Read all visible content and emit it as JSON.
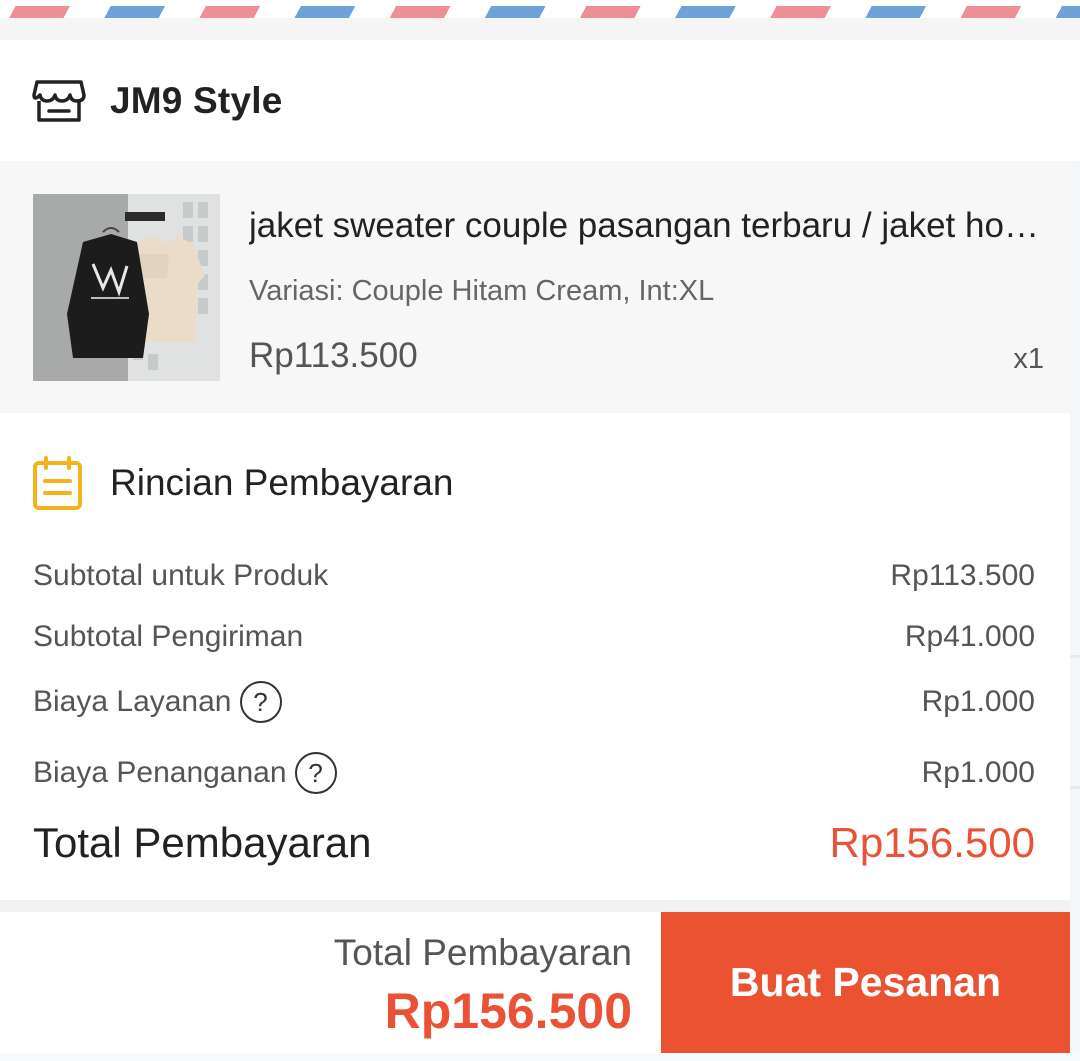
{
  "shop": {
    "name": "JM9 Style",
    "icon": "store-icon"
  },
  "product": {
    "title": "jaket sweater couple pasangan terbaru / jaket hoodie couple",
    "variation": "Variasi: Couple Hitam Cream, Int:XL",
    "price": "Rp113.500",
    "quantity": "x1",
    "thumbnail_icon": "product-photo"
  },
  "payment_details": {
    "title": "Rincian Pembayaran",
    "icon": "receipt-icon",
    "rows": [
      {
        "label": "Subtotal untuk Produk",
        "value": "Rp113.500"
      },
      {
        "label": "Subtotal Pengiriman",
        "value": "Rp41.000"
      },
      {
        "label": "Biaya Layanan",
        "value": "Rp1.000",
        "help": "?"
      },
      {
        "label": "Biaya Penanganan",
        "value": "Rp1.000",
        "help": "?"
      }
    ],
    "total_label": "Total Pembayaran",
    "total_value": "Rp156.500"
  },
  "bottom_bar": {
    "total_label": "Total Pembayaran",
    "total_value": "Rp156.500",
    "button_label": "Buat Pesanan"
  },
  "colors": {
    "accent": "#ea5235",
    "airmail_blue": "#6ea2d8",
    "airmail_red": "#ef8e96",
    "receipt_icon": "#f2b31b"
  }
}
